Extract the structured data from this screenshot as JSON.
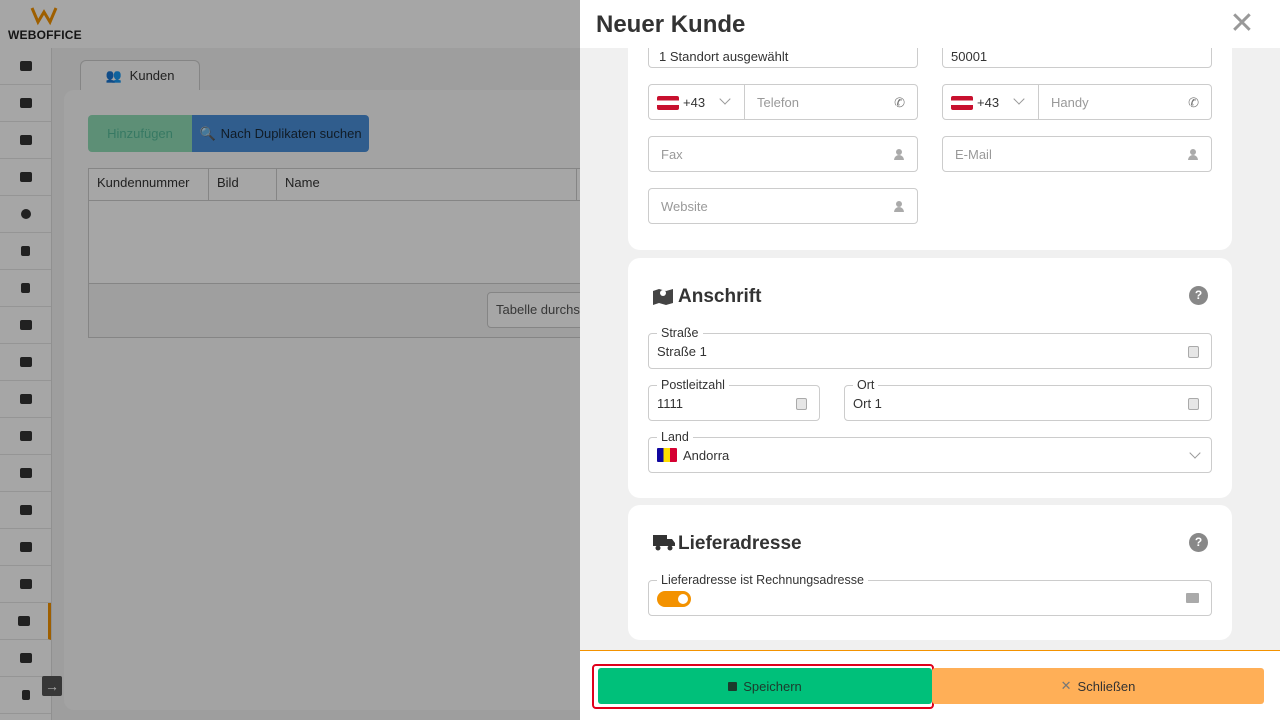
{
  "app": {
    "logo_text": "WEBOFFICE"
  },
  "background": {
    "tab_label": "Kunden",
    "add_button": "Hinzufügen",
    "duplicates_button": "Nach Duplikaten suchen",
    "table_headers": [
      "Kundennummer",
      "Bild",
      "Name"
    ],
    "table_search_placeholder": "Tabelle durchs"
  },
  "drawer": {
    "title": "Neuer Kunde",
    "contact": {
      "location_value": "1 Standort ausgewählt",
      "zip_partial": "50001",
      "phone_code": "+43",
      "phone_placeholder": "Telefon",
      "mobile_code": "+43",
      "mobile_placeholder": "Handy",
      "fax_placeholder": "Fax",
      "email_placeholder": "E-Mail",
      "website_placeholder": "Website"
    },
    "address": {
      "title": "Anschrift",
      "street_label": "Straße",
      "street_value": "Straße 1",
      "zip_label": "Postleitzahl",
      "zip_value": "1111",
      "city_label": "Ort",
      "city_value": "Ort 1",
      "country_label": "Land",
      "country_value": "Andorra"
    },
    "delivery": {
      "title": "Lieferadresse",
      "same_as_billing_label": "Lieferadresse ist Rechnungsadresse",
      "same_as_billing_on": true
    },
    "footer": {
      "save_label": "Speichern",
      "close_label": "Schließen"
    }
  },
  "colors": {
    "accent": "#f39200",
    "save": "#00c07a",
    "close": "#ffaf57",
    "highlight": "#e0001b"
  }
}
